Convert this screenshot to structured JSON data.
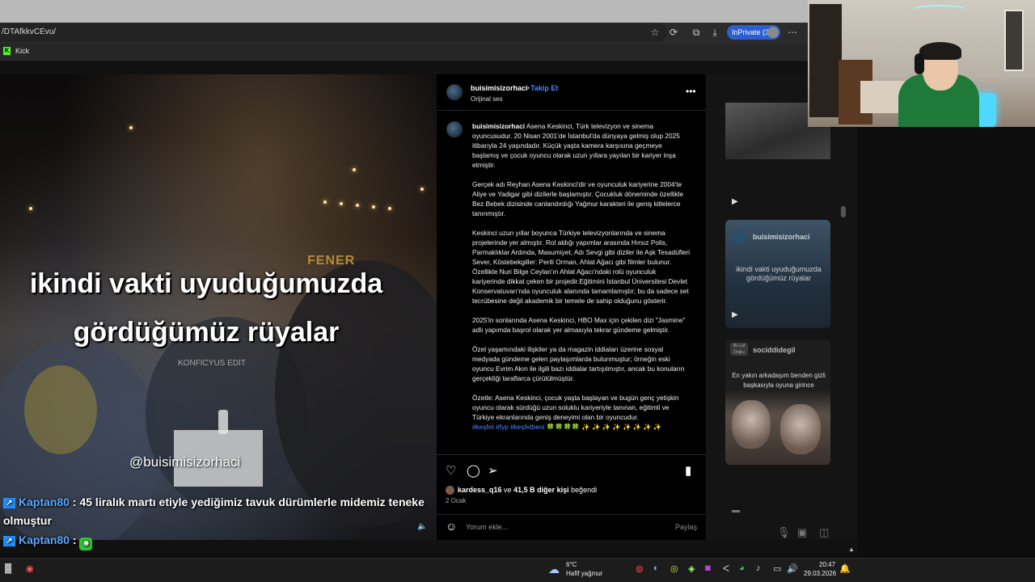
{
  "browser": {
    "url": "/DTAfkkvCEvu/",
    "inprivate_label": "InPrivate (3)",
    "favorites": [
      {
        "label": "Kick"
      }
    ],
    "icons": [
      "star-icon",
      "refresh-icon",
      "extensions-icon",
      "download-icon",
      "more-icon"
    ]
  },
  "video": {
    "caption_line1": "ikindi vakti uyuduğumuzda",
    "caption_line2": "gördüğümüz rüyalar",
    "edit_mark": "KONFICYUS EDIT",
    "watermark": "@buisimisizorhaci",
    "sign": "FENER"
  },
  "chat": [
    {
      "user": "Kaptan80",
      "message": ": 45 liralık martı etiyle yediğimiz tavuk dürümlerle midemiz teneke olmuştur"
    },
    {
      "user": "Kaptan80",
      "message": ":"
    }
  ],
  "post": {
    "username": "buisimisizorhaci",
    "follow_label": "Takip Et",
    "separator": "•",
    "audio": "Orijinal ses",
    "caption_user": "buisimisizorhaci",
    "paragraphs": [
      "Asena Keskinci, Türk televizyon ve sinema oyuncusudur. 20 Nisan 2001'de İstanbul'da dünyaya gelmiş olup 2025 itibarıyla 24 yaşındadır. Küçük yaşta kamera karşısına geçmeye başlamış ve çocuk oyuncu olarak uzun yıllara yayılan bir kariyer inşa etmiştir.",
      "Gerçek adı Reyhan Asena Keskinci'dir ve oyunculuk kariyerine 2004'te Aliye ve Yadigar gibi dizilerle başlamıştır. Çocukluk döneminde özellikle Bez Bebek dizisinde canlandırdığı Yağmur karakteri ile geniş kitlelerce tanınmıştır.",
      "Keskinci uzun yıllar boyunca Türkiye televizyonlarında ve sinema projelerinde yer almıştır. Rol aldığı yapımlar arasında Hırsız Polis, Parmaklıklar Ardında, Masumiyet, Adı Sevgi gibi diziler ile Aşk Tesadüfleri Sever, Köstebekgiller: Perili Orman, Ahlat Ağacı gibi filmler bulunur. Özellikle Nuri Bilge Ceylan'ın Ahlat Ağacı'ndaki rolü oyunculuk kariyerinde dikkat çeken bir projedir.Eğitimini İstanbul Üniversitesi Devlet Konservatuvarı'nda oyunculuk alanında tamamlamıştır; bu da sadece set tecrübesine değil akademik bir temele de sahip olduğunu gösterir.",
      "2025'in sonlarında Asena Keskinci, HBO Max için çekilen dizi \"Jasmine\" adlı yapımda başrol olarak yer almasıyla tekrar gündeme gelmiştir.",
      "Özel yaşamındaki ilişkiler ya da magazin iddiaları üzerine sosyal medyada gündeme gelen paylaşımlarda bulunmuştur; örneğin eski oyuncu Evrim Akın ile ilgili bazı iddialar tartışılmıştır, ancak bu konuların gerçekliği taraflarca çürütülmüştür.",
      "Özetle: Asena Keskinci, çocuk yaşta başlayan ve bugün genç yetişkin oyuncu olarak sürdüğü uzun soluklu kariyeriyle tanınan, eğitimli ve Türkiye ekranlarında geniş deneyimi olan bir oyuncudur."
    ],
    "hashtags": "#keşfet #fyp #keşfetbeni 🍀🍀🍀🍀 ✨ ✨ ✨ ✨ ✨ ✨ ✨ ✨",
    "likes_user": "kardess_q16",
    "likes_mid": " ve ",
    "likes_count": "41,5 B diğer kişi",
    "likes_suffix": " beğendi",
    "date": "2 Ocak",
    "comment_placeholder": "Yorum ekle...",
    "share_label": "Paylaş"
  },
  "sidebar": {
    "thumb2_user": "buisimisizorhaci",
    "thumb2_caption": "ikindi vakti uyuduğumuzda gördüğümüz rüyalar",
    "thumb3_user": "sociddidegil",
    "thumb3_badge": "Bu Laf Doğru",
    "thumb3_caption": "En yakın arkadaşım benden gizli başkasıyla oyuna girince"
  },
  "taskbar": {
    "temperature": "6°C",
    "weather": "Hafif yağmur",
    "time": "20:47",
    "date": "29.03.2026"
  }
}
